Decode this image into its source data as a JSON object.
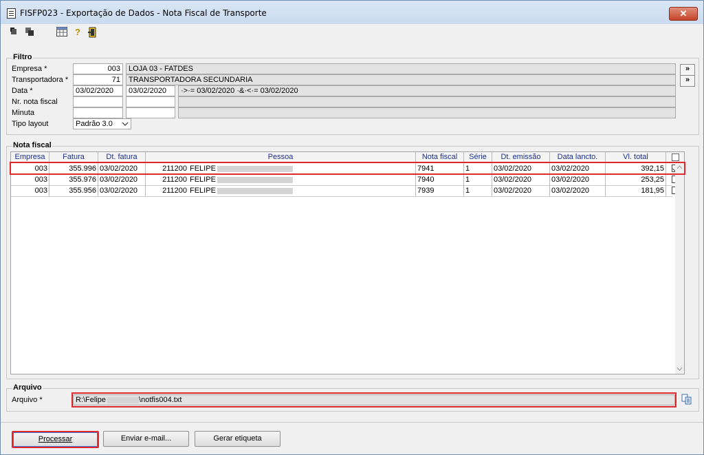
{
  "window": {
    "title": "FISFP023 - Exportação de Dados - Nota Fiscal de Transporte",
    "close_glyph": "✕"
  },
  "toolbar": {
    "icons": [
      "export-icon",
      "import-icon",
      "grid-icon",
      "help-icon",
      "exit-icon"
    ],
    "help_glyph": "?"
  },
  "filtro": {
    "title": "Filtro",
    "empresa": {
      "label": "Empresa *",
      "code": "003",
      "name": "LOJA 03 - FATDES"
    },
    "transportadora": {
      "label": "Transportadora *",
      "code": "71",
      "name": "TRANSPORTADORA SECUNDARIA"
    },
    "data": {
      "label": "Data *",
      "from": "03/02/2020",
      "to": "03/02/2020",
      "desc": "·>·= 03/02/2020 ·&·<·= 03/02/2020"
    },
    "nr_nota": {
      "label": "Nr. nota fiscal",
      "from": "",
      "to": ""
    },
    "minuta": {
      "label": "Minuta",
      "from": "",
      "to": ""
    },
    "tipo_layout": {
      "label": "Tipo layout",
      "value": "Padrão 3.0"
    },
    "search_glyph": "»"
  },
  "nota_fiscal": {
    "title": "Nota fiscal",
    "columns": [
      "Empresa",
      "Fatura",
      "Dt. fatura",
      "Pessoa",
      "Nota fiscal",
      "Série",
      "Dt. emissão",
      "Data lancto.",
      "Vl. total"
    ],
    "rows": [
      {
        "empresa": "003",
        "fatura": "355.996",
        "dt_fatura": "03/02/2020",
        "pessoa_cod": "211200",
        "pessoa_nome": "FELIPE",
        "nota": "7941",
        "serie": "1",
        "dt_emissao": "03/02/2020",
        "data_lancto": "03/02/2020",
        "vl_total": "392,15",
        "checked": true
      },
      {
        "empresa": "003",
        "fatura": "355.976",
        "dt_fatura": "03/02/2020",
        "pessoa_cod": "211200",
        "pessoa_nome": "FELIPE",
        "nota": "7940",
        "serie": "1",
        "dt_emissao": "03/02/2020",
        "data_lancto": "03/02/2020",
        "vl_total": "253,25",
        "checked": false
      },
      {
        "empresa": "003",
        "fatura": "355.956",
        "dt_fatura": "03/02/2020",
        "pessoa_cod": "211200",
        "pessoa_nome": "FELIPE",
        "nota": "7939",
        "serie": "1",
        "dt_emissao": "03/02/2020",
        "data_lancto": "03/02/2020",
        "vl_total": "181,95",
        "checked": false
      }
    ]
  },
  "arquivo": {
    "title": "Arquivo",
    "label": "Arquivo *",
    "path_prefix": "R:\\Felipe",
    "path_suffix": "\\notfis004.txt"
  },
  "buttons": {
    "processar": "Processar",
    "enviar": "Enviar e-mail...",
    "gerar": "Gerar etiqueta"
  },
  "colors": {
    "highlight": "#e0282c",
    "header_text": "#1a2f8c",
    "title_bar": "#c9daef"
  }
}
